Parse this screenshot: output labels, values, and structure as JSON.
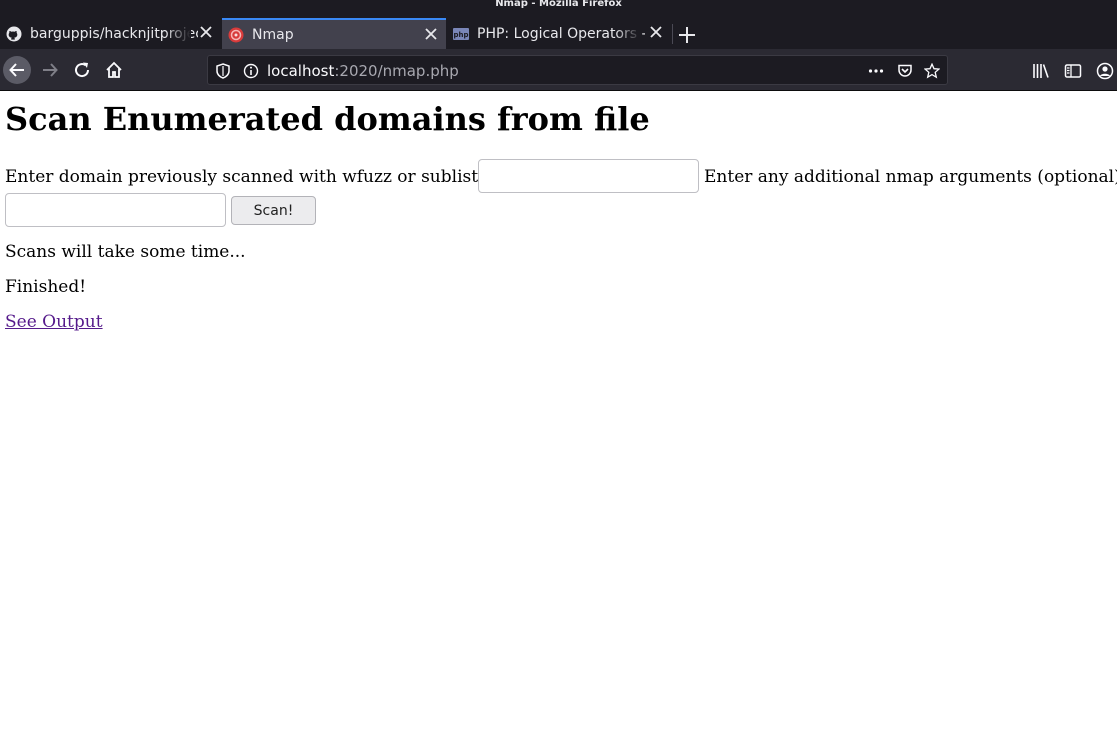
{
  "window": {
    "title": "Nmap - Mozilla Firefox"
  },
  "tabs": [
    {
      "title": "barguppis/hacknjitproject",
      "icon": "github-icon",
      "active": false
    },
    {
      "title": "Nmap",
      "icon": "nmap-favicon-icon",
      "active": true
    },
    {
      "title": "PHP: Logical Operators - Manual",
      "icon": "php-favicon-icon",
      "active": false
    }
  ],
  "toolbar": {
    "url_host": "localhost",
    "url_rest": ":2020/nmap.php",
    "icons": [
      "back-icon",
      "forward-icon",
      "reload-icon",
      "home-icon",
      "tracking-shield-icon",
      "site-info-icon",
      "page-actions-icon",
      "pocket-icon",
      "bookmark-star-icon",
      "library-icon",
      "sidebar-icon",
      "account-icon"
    ]
  },
  "page": {
    "heading": "Scan Enumerated domains from file",
    "domain_label": "Enter domain previously scanned with wfuzz or sublister:",
    "domain_value": "",
    "args_label": "Enter any additional nmap arguments (optional):",
    "args_value": "",
    "scan_button": "Scan!",
    "status_wait": "Scans will take some time...",
    "status_done": "Finished!",
    "output_link": "See Output"
  },
  "colors": {
    "chrome_dark": "#1c1b22",
    "tab_active": "#42414d",
    "tab_accent": "#3a89f5",
    "toolbar": "#2b2a33",
    "visited_link": "#551a8b"
  }
}
